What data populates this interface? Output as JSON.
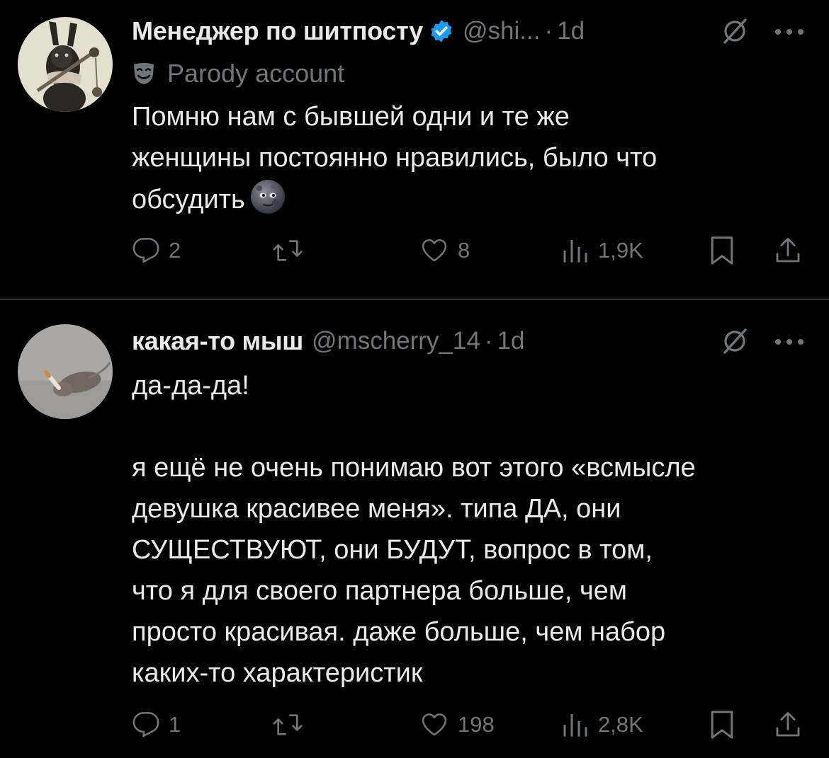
{
  "tweets": [
    {
      "display_name": "Менеджер по шитпосту",
      "handle": "@shi...",
      "time": "1d",
      "parody_label": "Parody account",
      "text": "Помню нам с бывшей одни и те же\nженщины постоянно нравились, было что\nобсудить",
      "emoji": "moon-face",
      "avatar": "rabbit-with-mace",
      "verified": true,
      "actions": {
        "replies": "2",
        "reposts": "",
        "likes": "8",
        "views": "1,9K"
      }
    },
    {
      "display_name": "какая-то мыш",
      "handle": "@mscherry_14",
      "time": "1d",
      "text": "да-да-да!\n\nя ещё не очень понимаю вот этого «всмысле\nдевушка красивее меня». типа ДА, они\nСУЩЕСТВУЮТ, они БУДУТ, вопрос в том,\nчто я для своего партнера больше, чем\nпросто красивая. даже больше, чем набор\nкаких-то характеристик",
      "avatar": "mouse-with-cigarette",
      "verified": false,
      "actions": {
        "replies": "1",
        "reposts": "",
        "likes": "198",
        "views": "2,8K"
      }
    }
  ],
  "colors": {
    "background": "#000000",
    "text": "#e7e9ea",
    "muted": "#71767b",
    "verified": "#1d9bf0",
    "divider": "#2f3336"
  }
}
